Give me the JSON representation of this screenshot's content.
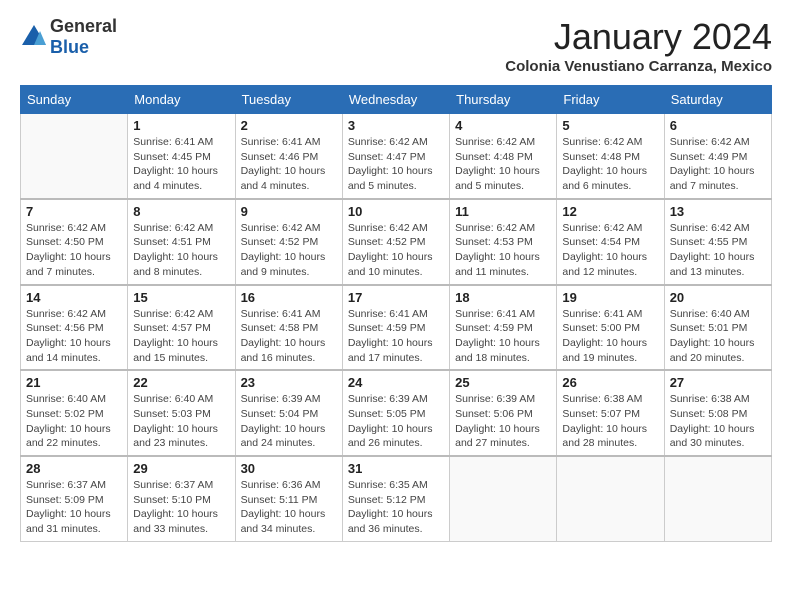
{
  "logo": {
    "general": "General",
    "blue": "Blue"
  },
  "header": {
    "month": "January 2024",
    "location": "Colonia Venustiano Carranza, Mexico"
  },
  "weekdays": [
    "Sunday",
    "Monday",
    "Tuesday",
    "Wednesday",
    "Thursday",
    "Friday",
    "Saturday"
  ],
  "weeks": [
    [
      {
        "day": "",
        "info": ""
      },
      {
        "day": "1",
        "info": "Sunrise: 6:41 AM\nSunset: 4:45 PM\nDaylight: 10 hours\nand 4 minutes."
      },
      {
        "day": "2",
        "info": "Sunrise: 6:41 AM\nSunset: 4:46 PM\nDaylight: 10 hours\nand 4 minutes."
      },
      {
        "day": "3",
        "info": "Sunrise: 6:42 AM\nSunset: 4:47 PM\nDaylight: 10 hours\nand 5 minutes."
      },
      {
        "day": "4",
        "info": "Sunrise: 6:42 AM\nSunset: 4:48 PM\nDaylight: 10 hours\nand 5 minutes."
      },
      {
        "day": "5",
        "info": "Sunrise: 6:42 AM\nSunset: 4:48 PM\nDaylight: 10 hours\nand 6 minutes."
      },
      {
        "day": "6",
        "info": "Sunrise: 6:42 AM\nSunset: 4:49 PM\nDaylight: 10 hours\nand 7 minutes."
      }
    ],
    [
      {
        "day": "7",
        "info": "Sunrise: 6:42 AM\nSunset: 4:50 PM\nDaylight: 10 hours\nand 7 minutes."
      },
      {
        "day": "8",
        "info": "Sunrise: 6:42 AM\nSunset: 4:51 PM\nDaylight: 10 hours\nand 8 minutes."
      },
      {
        "day": "9",
        "info": "Sunrise: 6:42 AM\nSunset: 4:52 PM\nDaylight: 10 hours\nand 9 minutes."
      },
      {
        "day": "10",
        "info": "Sunrise: 6:42 AM\nSunset: 4:52 PM\nDaylight: 10 hours\nand 10 minutes."
      },
      {
        "day": "11",
        "info": "Sunrise: 6:42 AM\nSunset: 4:53 PM\nDaylight: 10 hours\nand 11 minutes."
      },
      {
        "day": "12",
        "info": "Sunrise: 6:42 AM\nSunset: 4:54 PM\nDaylight: 10 hours\nand 12 minutes."
      },
      {
        "day": "13",
        "info": "Sunrise: 6:42 AM\nSunset: 4:55 PM\nDaylight: 10 hours\nand 13 minutes."
      }
    ],
    [
      {
        "day": "14",
        "info": "Sunrise: 6:42 AM\nSunset: 4:56 PM\nDaylight: 10 hours\nand 14 minutes."
      },
      {
        "day": "15",
        "info": "Sunrise: 6:42 AM\nSunset: 4:57 PM\nDaylight: 10 hours\nand 15 minutes."
      },
      {
        "day": "16",
        "info": "Sunrise: 6:41 AM\nSunset: 4:58 PM\nDaylight: 10 hours\nand 16 minutes."
      },
      {
        "day": "17",
        "info": "Sunrise: 6:41 AM\nSunset: 4:59 PM\nDaylight: 10 hours\nand 17 minutes."
      },
      {
        "day": "18",
        "info": "Sunrise: 6:41 AM\nSunset: 4:59 PM\nDaylight: 10 hours\nand 18 minutes."
      },
      {
        "day": "19",
        "info": "Sunrise: 6:41 AM\nSunset: 5:00 PM\nDaylight: 10 hours\nand 19 minutes."
      },
      {
        "day": "20",
        "info": "Sunrise: 6:40 AM\nSunset: 5:01 PM\nDaylight: 10 hours\nand 20 minutes."
      }
    ],
    [
      {
        "day": "21",
        "info": "Sunrise: 6:40 AM\nSunset: 5:02 PM\nDaylight: 10 hours\nand 22 minutes."
      },
      {
        "day": "22",
        "info": "Sunrise: 6:40 AM\nSunset: 5:03 PM\nDaylight: 10 hours\nand 23 minutes."
      },
      {
        "day": "23",
        "info": "Sunrise: 6:39 AM\nSunset: 5:04 PM\nDaylight: 10 hours\nand 24 minutes."
      },
      {
        "day": "24",
        "info": "Sunrise: 6:39 AM\nSunset: 5:05 PM\nDaylight: 10 hours\nand 26 minutes."
      },
      {
        "day": "25",
        "info": "Sunrise: 6:39 AM\nSunset: 5:06 PM\nDaylight: 10 hours\nand 27 minutes."
      },
      {
        "day": "26",
        "info": "Sunrise: 6:38 AM\nSunset: 5:07 PM\nDaylight: 10 hours\nand 28 minutes."
      },
      {
        "day": "27",
        "info": "Sunrise: 6:38 AM\nSunset: 5:08 PM\nDaylight: 10 hours\nand 30 minutes."
      }
    ],
    [
      {
        "day": "28",
        "info": "Sunrise: 6:37 AM\nSunset: 5:09 PM\nDaylight: 10 hours\nand 31 minutes."
      },
      {
        "day": "29",
        "info": "Sunrise: 6:37 AM\nSunset: 5:10 PM\nDaylight: 10 hours\nand 33 minutes."
      },
      {
        "day": "30",
        "info": "Sunrise: 6:36 AM\nSunset: 5:11 PM\nDaylight: 10 hours\nand 34 minutes."
      },
      {
        "day": "31",
        "info": "Sunrise: 6:35 AM\nSunset: 5:12 PM\nDaylight: 10 hours\nand 36 minutes."
      },
      {
        "day": "",
        "info": ""
      },
      {
        "day": "",
        "info": ""
      },
      {
        "day": "",
        "info": ""
      }
    ]
  ]
}
